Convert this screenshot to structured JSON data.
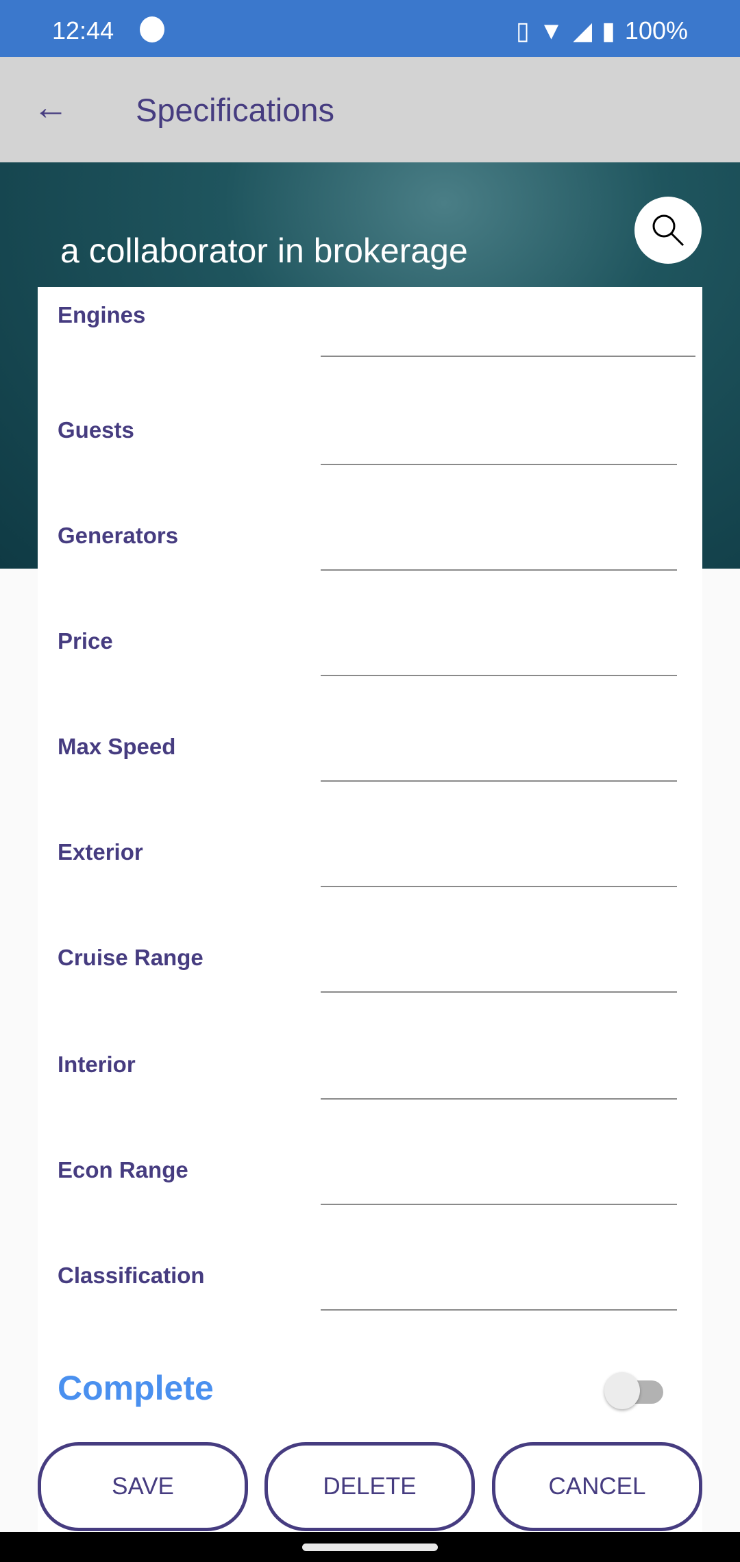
{
  "status_bar": {
    "time": "12:44",
    "battery": "100%",
    "icons": [
      "vibrate-icon",
      "wifi-icon",
      "signal-icon",
      "battery-charging-icon"
    ]
  },
  "app_bar": {
    "title": "Specifications",
    "back_icon": "arrow-left-icon"
  },
  "banner": {
    "text": "a collaborator in brokerage",
    "search_icon": "search-icon"
  },
  "fields": [
    {
      "label": "Engines",
      "value": ""
    },
    {
      "label": "Guests",
      "value": ""
    },
    {
      "label": "Generators",
      "value": ""
    },
    {
      "label": "Price",
      "value": ""
    },
    {
      "label": "Max Speed",
      "value": ""
    },
    {
      "label": "Exterior",
      "value": ""
    },
    {
      "label": "Cruise Range",
      "value": ""
    },
    {
      "label": "Interior",
      "value": ""
    },
    {
      "label": "Econ Range",
      "value": ""
    },
    {
      "label": "Classification",
      "value": ""
    }
  ],
  "complete": {
    "label": "Complete",
    "checked": false
  },
  "buttons": {
    "save": "SAVE",
    "delete": "DELETE",
    "cancel": "CANCEL"
  },
  "colors": {
    "status_bar": "#3b78cc",
    "accent": "#463c80",
    "complete": "#4a90ef"
  }
}
